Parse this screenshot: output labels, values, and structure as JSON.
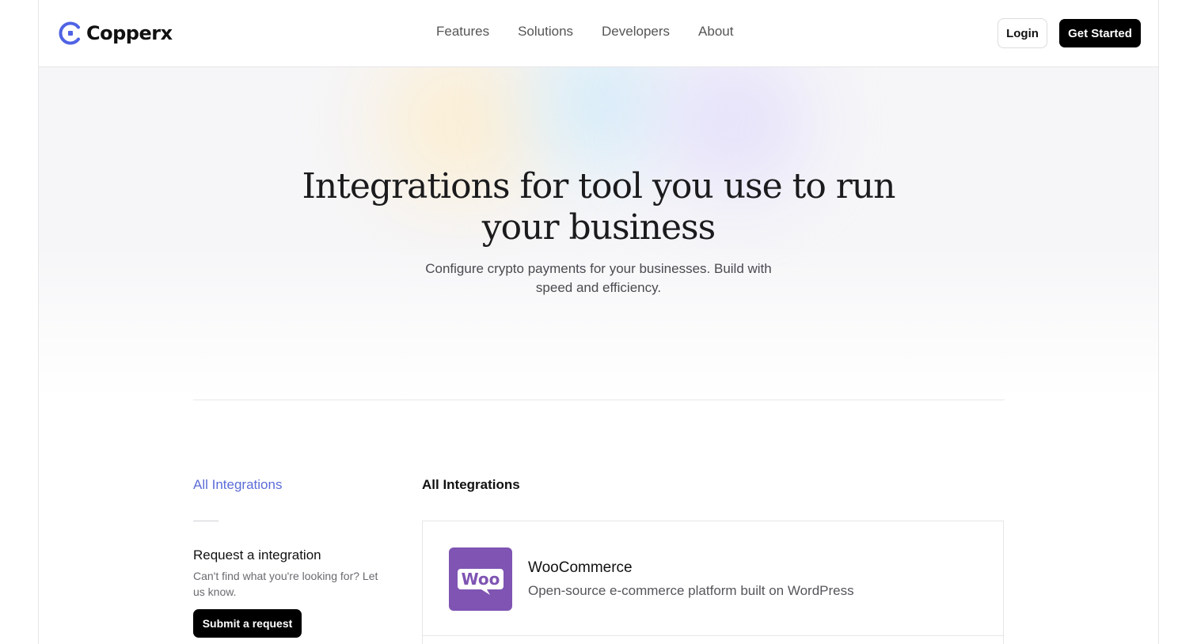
{
  "brand": {
    "name": "Copperx",
    "accent": "#4f63e4"
  },
  "nav": {
    "items": [
      "Features",
      "Solutions",
      "Developers",
      "About"
    ],
    "login_label": "Login",
    "get_started_label": "Get Started"
  },
  "hero": {
    "title_line1": "Integrations for tool you use to run",
    "title_line2": "your business",
    "subtitle": "Configure crypto payments for your businesses. Build with speed and efficiency."
  },
  "sidebar": {
    "all_link": "All Integrations",
    "request_title": "Request a integration",
    "request_text": "Can't find what you're looking for? Let us know.",
    "submit_label": "Submit a request"
  },
  "main": {
    "heading": "All Integrations",
    "integrations": [
      {
        "name": "WooCommerce",
        "description": "Open-source e-commerce platform built on WordPress",
        "icon": "woocommerce-icon",
        "icon_color": "#7f54b3",
        "logo_text": "Woo"
      }
    ]
  }
}
